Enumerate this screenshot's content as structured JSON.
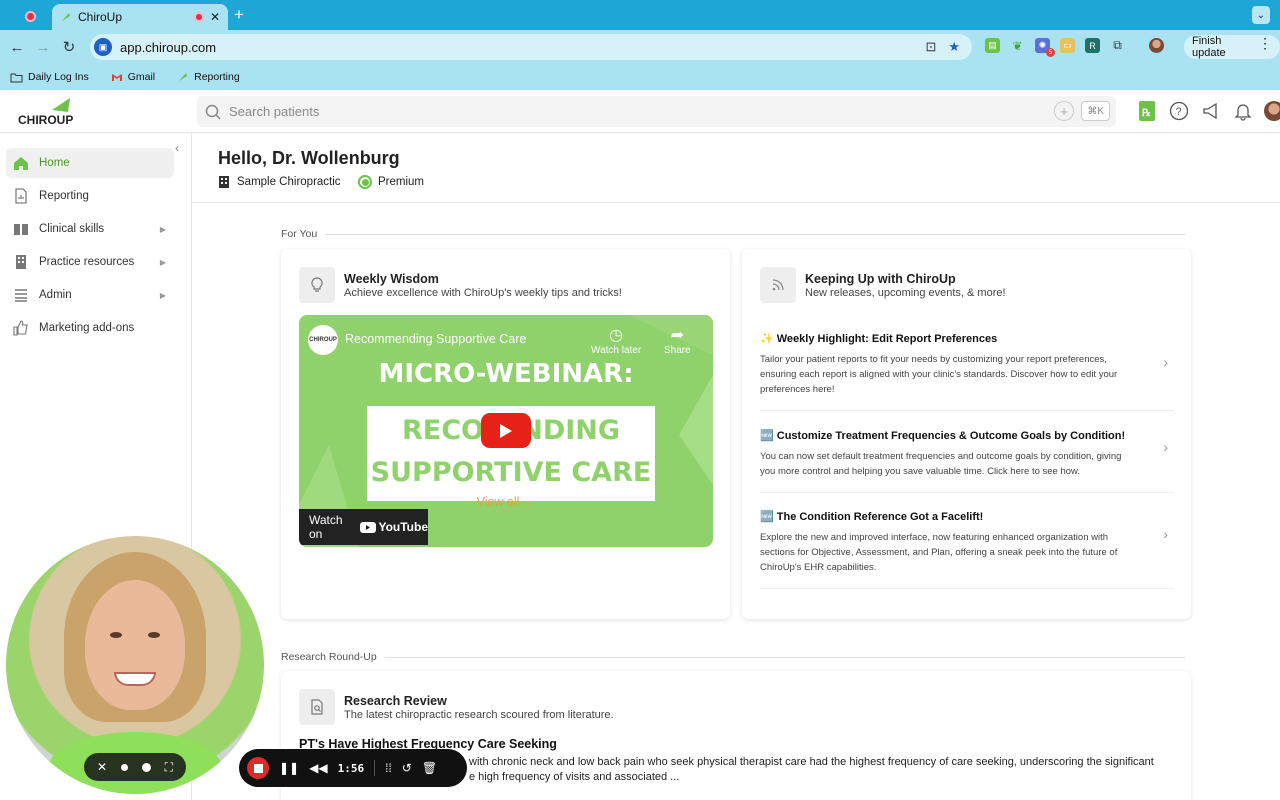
{
  "browser": {
    "active_tab_title": "ChiroUp",
    "url": "app.chiroup.com",
    "finish_update_label": "Finish update",
    "bookmarks": [
      {
        "label": "Daily Log Ins",
        "icon": "folder-icon"
      },
      {
        "label": "Gmail",
        "icon": "gmail-icon"
      },
      {
        "label": "Reporting",
        "icon": "chiroup-icon"
      }
    ],
    "extension_badge": "5"
  },
  "app": {
    "logo_text": "CHIROUP",
    "search_placeholder": "Search patients",
    "search_shortcut": "⌘K"
  },
  "sidebar": {
    "items": [
      {
        "label": "Home",
        "icon": "home-icon",
        "active": true,
        "has_submenu": false
      },
      {
        "label": "Reporting",
        "icon": "report-icon",
        "active": false,
        "has_submenu": false
      },
      {
        "label": "Clinical skills",
        "icon": "book-icon",
        "active": false,
        "has_submenu": true
      },
      {
        "label": "Practice resources",
        "icon": "building-icon",
        "active": false,
        "has_submenu": true
      },
      {
        "label": "Admin",
        "icon": "list-icon",
        "active": false,
        "has_submenu": true
      },
      {
        "label": "Marketing add-ons",
        "icon": "thumbs-up-icon",
        "active": false,
        "has_submenu": false
      }
    ]
  },
  "main": {
    "greeting": "Hello, Dr. Wollenburg",
    "clinic_name": "Sample Chiropractic",
    "plan": "Premium",
    "for_you_label": "For You",
    "weekly_wisdom": {
      "title": "Weekly Wisdom",
      "subtitle": "Achieve excellence with ChiroUp's weekly tips and tricks!",
      "video": {
        "title": "Recommending Supportive Care",
        "watch_later": "Watch later",
        "share": "Share",
        "headline": "MICRO-WEBINAR:",
        "line1": "RECOM   NDING",
        "line2": "SUPPORTIVE CARE",
        "watch_on": "Watch on",
        "youtube": "YouTube"
      },
      "view_all": "View all →"
    },
    "keeping_up": {
      "title": "Keeping Up with ChiroUp",
      "subtitle": "New releases, upcoming events, & more!",
      "items": [
        {
          "title": "✨ Weekly Highlight: Edit Report Preferences",
          "desc": "Tailor your patient reports to fit your needs by customizing your report preferences, ensuring each report is aligned with your clinic's standards. Discover how to edit your preferences here!"
        },
        {
          "title": "🆕 Customize Treatment Frequencies & Outcome Goals by Condition!",
          "desc": "You can now set default treatment frequencies and outcome goals by condition, giving you more control and helping you save valuable time. Click here to see how."
        },
        {
          "title": "🆕 The Condition Reference Got a Facelift!",
          "desc": "Explore the new and improved interface, now featuring enhanced organization with sections for Objective, Assessment, and Plan, offering a sneak peek into the future of ChiroUp's EHR capabilities."
        }
      ]
    },
    "research_label": "Research Round-Up",
    "research": {
      "title": "Research Review",
      "subtitle": "The latest chiropractic research scoured from literature.",
      "article_title": "PT's Have Highest Frequency Care Seeking",
      "article_line1": "with chronic neck and low back pain who seek physical therapist care had the highest frequency of care seeking, underscoring the significant",
      "article_line2": "e high frequency of visits and associated ..."
    }
  },
  "recorder": {
    "time": "1:56"
  }
}
